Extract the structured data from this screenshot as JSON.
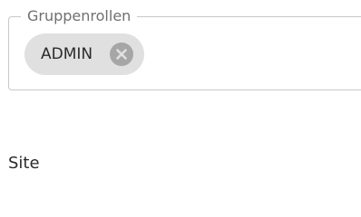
{
  "group_roles": {
    "legend": "Gruppenrollen",
    "chips": [
      {
        "label": "ADMIN",
        "remove_icon": "close-circle-icon"
      }
    ]
  },
  "site": {
    "label": "Site"
  },
  "colors": {
    "border": "#c8c8c8",
    "legend_text": "#6f6f6f",
    "chip_bg": "#e0e0e0",
    "chip_remove_icon": "#a6a6a6",
    "text": "#2b2b2b"
  }
}
